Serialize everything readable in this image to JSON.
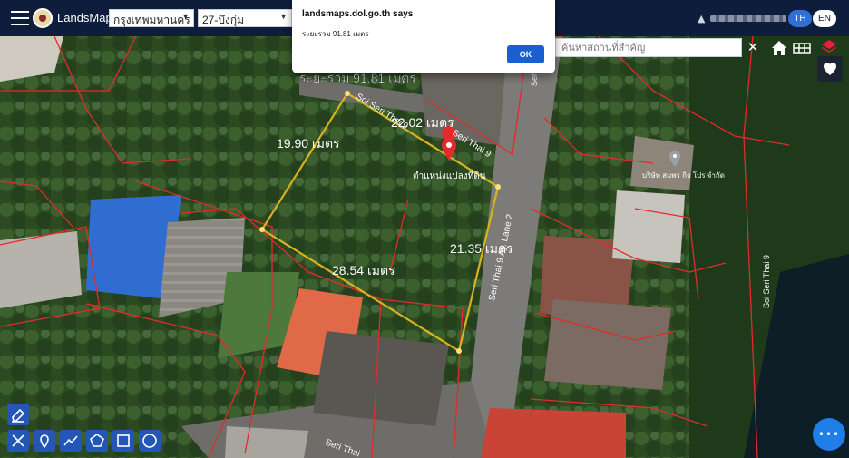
{
  "app": {
    "brand": "LandsMaps"
  },
  "header": {
    "province": "กรุงเทพมหานคร",
    "district": "27-บึงกุ่ม",
    "lang_th": "TH",
    "lang_en": "EN"
  },
  "search": {
    "placeholder": "ค้นหาสถานที่สำคัญ",
    "clear": "✕"
  },
  "dialog": {
    "title": "landsmaps.dol.go.th says",
    "message": "ระยะรวม 91.81 เมตร",
    "ok": "OK"
  },
  "map": {
    "total_label": "ระยะรวม 91.81 เมตร",
    "measurements": [
      {
        "label": "19.90 เมตร"
      },
      {
        "label": "22.02 เมตร"
      },
      {
        "label": "21.35 เมตร"
      },
      {
        "label": "28.54 เมตร"
      }
    ],
    "parcel_label": "ตำแหน่งแปลงที่ดิน",
    "road_labels": [
      "Soi Seri Thai 9",
      "Seri Thai 9",
      "Seri Thai 9 Ay. Lane 2",
      "Soi Seri Thai 9",
      "Seri Thai",
      "Seri Thai 9"
    ],
    "place_label": "บริษัท สมพร กิจ โปร จำกัด",
    "colors": {
      "measure": "#d8b21e",
      "parcel": "#e32b2b",
      "vertex": "#f5e27a"
    }
  },
  "tools": {
    "eraser": "eraser-icon",
    "items": [
      "measure-tools-icon",
      "location-pin-icon",
      "polyline-icon",
      "polygon-icon",
      "rectangle-icon",
      "circle-icon"
    ]
  },
  "fab": {
    "icon": "•••"
  }
}
